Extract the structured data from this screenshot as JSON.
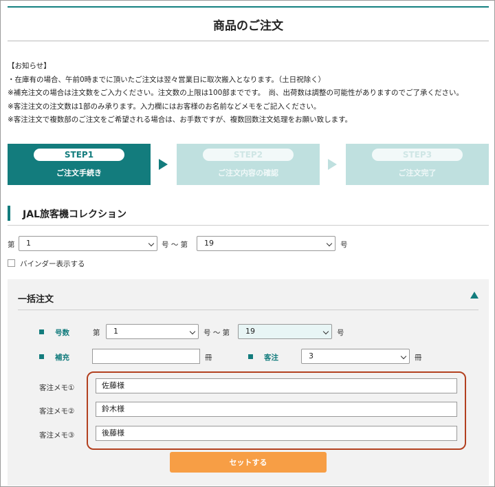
{
  "page": {
    "title": "商品のご注文"
  },
  "notice": {
    "lines": [
      "【お知らせ】",
      "・在庫有の場合、午前0時までに頂いたご注文は翌々営業日に取次搬入となります。（土日祝除く）",
      "※補充注文の場合は注文数をご入力ください。注文数の上限は100部までです。　尚、出荷数は調整の可能性がありますのでご了承ください。",
      "※客注注文の注文数は1部のみ承ります。入力欄にはお客様のお名前などメモをご記入ください。",
      "※客注注文で複数部のご注文をご希望される場合は、お手数ですが、複数回数注文処理をお願い致します。"
    ]
  },
  "steps": [
    {
      "num": "STEP1",
      "label": "ご注文手続き"
    },
    {
      "num": "STEP2",
      "label": "ご注文内容の確認"
    },
    {
      "num": "STEP3",
      "label": "ご注文完了"
    }
  ],
  "section": {
    "title": "JAL旅客機コレクション"
  },
  "range": {
    "prefix": "第",
    "from": "1",
    "mid": "号 〜 第",
    "to": "19",
    "suffix": "号"
  },
  "binder": {
    "label": "バインダー表示する"
  },
  "bulk": {
    "title": "一括注文",
    "issue_label": "号数",
    "issue_prefix": "第",
    "issue_from": "1",
    "issue_mid": "号 〜 第",
    "issue_to": "19",
    "issue_suffix": "号",
    "refill_label": "補充",
    "refill_value": "",
    "unit": "冊",
    "customer_label": "客注",
    "customer_value": "3",
    "memos": [
      {
        "label": "客注メモ①",
        "value": "佐藤様"
      },
      {
        "label": "客注メモ②",
        "value": "鈴木様"
      },
      {
        "label": "客注メモ③",
        "value": "後藤様"
      }
    ],
    "set_button": "セットする"
  },
  "colors": {
    "accent": "#137c7d",
    "step_inactive": "#bfe0df",
    "highlight_border": "#b2401f",
    "button": "#f79e45"
  }
}
